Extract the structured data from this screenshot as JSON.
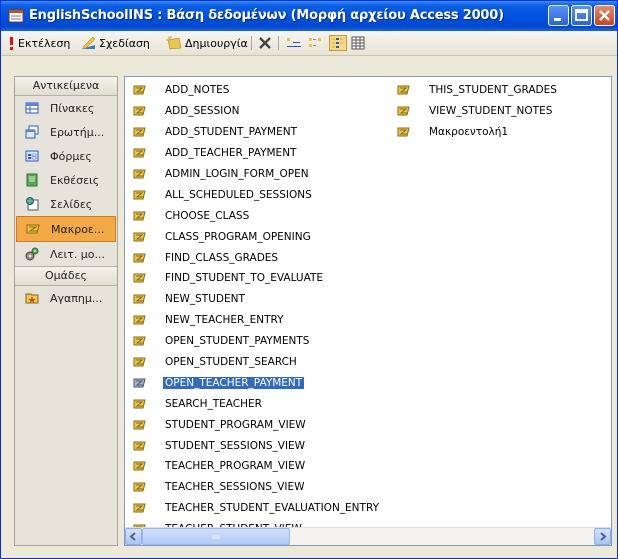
{
  "window": {
    "title": "EnglishSchoolINS : Βάση δεδομένων (Μορφή αρχείου Access 2000)"
  },
  "toolbar": {
    "run_label": "Εκτέλεση",
    "design_label": "Σχεδίαση",
    "create_label": "Δημιουργία"
  },
  "sidebar": {
    "objects_header": "Αντικείμενα",
    "items": [
      {
        "label": "Πίνακες",
        "icon": "table-icon"
      },
      {
        "label": "Ερωτήμ...",
        "icon": "query-icon"
      },
      {
        "label": "Φόρμες",
        "icon": "form-icon"
      },
      {
        "label": "Εκθέσεις",
        "icon": "report-icon"
      },
      {
        "label": "Σελίδες",
        "icon": "page-icon"
      },
      {
        "label": "Μακροε...",
        "icon": "macro-icon",
        "selected": true
      },
      {
        "label": "Λειτ. μο...",
        "icon": "module-icon"
      }
    ],
    "groups_header": "Ομάδες",
    "group_items": [
      {
        "label": "Αγαπημ...",
        "icon": "favorites-icon"
      }
    ]
  },
  "macros": {
    "column1": [
      "ADD_NOTES",
      "ADD_SESSION",
      "ADD_STUDENT_PAYMENT",
      "ADD_TEACHER_PAYMENT",
      "ADMIN_LOGIN_FORM_OPEN",
      "ALL_SCHEDULED_SESSIONS",
      "CHOOSE_CLASS",
      "CLASS_PROGRAM_OPENING",
      "FIND_CLASS_GRADES",
      "FIND_STUDENT_TO_EVALUATE",
      "NEW_STUDENT",
      "NEW_TEACHER_ENTRY",
      "OPEN_STUDENT_PAYMENTS",
      "OPEN_STUDENT_SEARCH",
      "OPEN_TEACHER_PAYMENT",
      "SEARCH_TEACHER",
      "STUDENT_PROGRAM_VIEW",
      "STUDENT_SESSIONS_VIEW",
      "TEACHER_PROGRAM_VIEW",
      "TEACHER_SESSIONS_VIEW",
      "TEACHER_STUDENT_EVALUATION_ENTRY",
      "TEACHER_STUDENT_VIEW"
    ],
    "column2": [
      "THIS_STUDENT_GRADES",
      "VIEW_STUDENT_NOTES",
      "Μακροεντολή1"
    ],
    "selected": "OPEN_TEACHER_PAYMENT"
  },
  "colors": {
    "titlebar": "#0052df",
    "selection": "#316ac5",
    "sidebar_selected": "#f3a946"
  }
}
